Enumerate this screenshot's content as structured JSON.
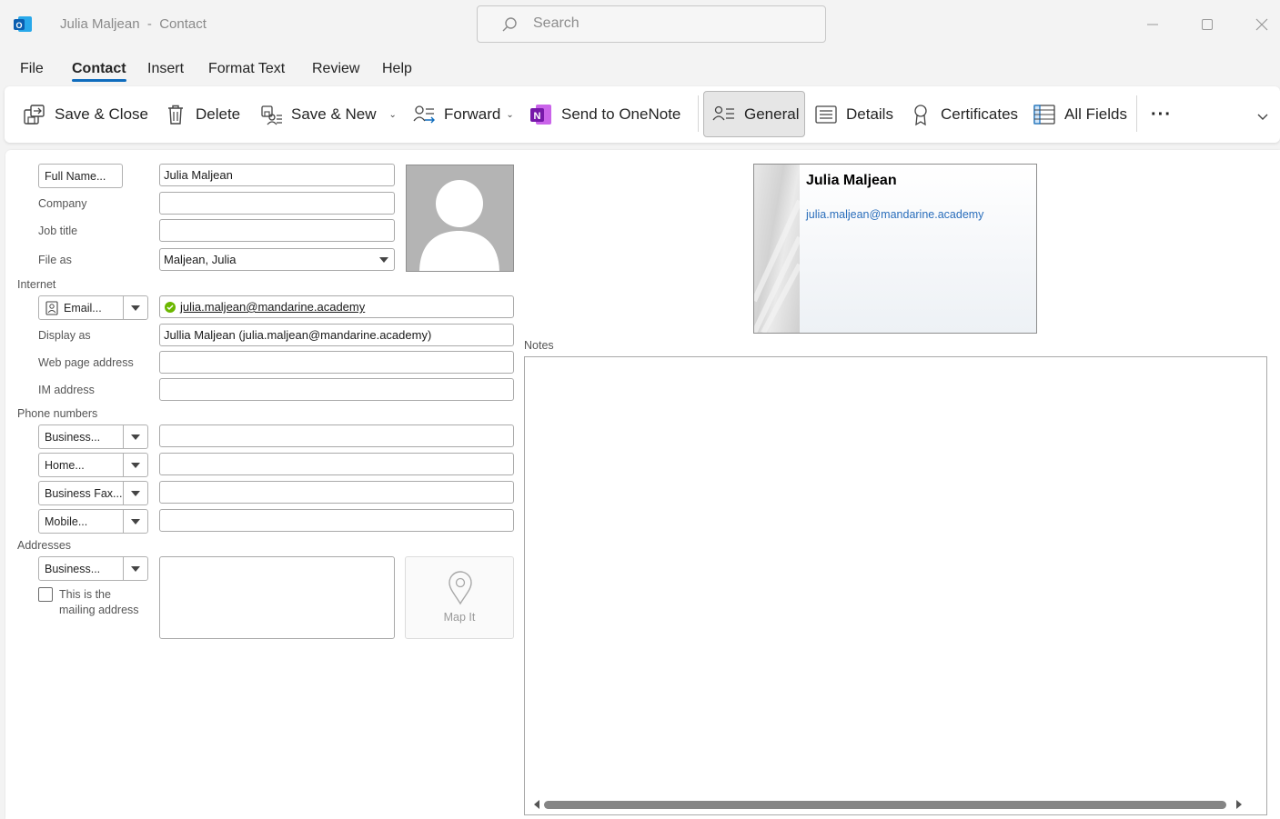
{
  "window": {
    "title": "Julia Maljean  -  Contact",
    "search_placeholder": "Search"
  },
  "menu": {
    "items": [
      "File",
      "Contact",
      "Insert",
      "Format Text",
      "Review",
      "Help"
    ],
    "active": "Contact"
  },
  "ribbon": {
    "save_close": "Save & Close",
    "delete": "Delete",
    "save_new": "Save & New",
    "forward": "Forward",
    "send_onenote": "Send to OneNote",
    "general": "General",
    "details": "Details",
    "certificates": "Certificates",
    "all_fields": "All Fields",
    "more": "···"
  },
  "form": {
    "full_name_button": "Full Name...",
    "full_name_value": "Julia Maljean",
    "company_label": "Company",
    "company_value": "",
    "job_title_label": "Job title",
    "job_title_value": "",
    "file_as_label": "File as",
    "file_as_value": "Maljean, Julia",
    "internet_section": "Internet",
    "email_button": "Email...",
    "email_value": "julia.maljean@mandarine.academy",
    "display_as_label": "Display as",
    "display_as_value": "Jullia Maljean (julia.maljean@mandarine.academy)",
    "web_page_label": "Web page address",
    "web_page_value": "",
    "im_label": "IM address",
    "im_value": "",
    "phone_section": "Phone numbers",
    "phones": [
      {
        "type": "Business...",
        "value": ""
      },
      {
        "type": "Home...",
        "value": ""
      },
      {
        "type": "Business Fax...",
        "value": ""
      },
      {
        "type": "Mobile...",
        "value": ""
      }
    ],
    "addresses_section": "Addresses",
    "address_type": "Business...",
    "address_value": "",
    "mailing_checkbox_line1": "This is the",
    "mailing_checkbox_line2": "mailing address",
    "mailing_checked": false,
    "map_it": "Map It"
  },
  "card": {
    "name": "Julia Maljean",
    "email": "julia.maljean@mandarine.academy"
  },
  "notes": {
    "label": "Notes",
    "value": ""
  },
  "colors": {
    "accent": "#0f6cbd",
    "email_link": "#2a6ebb",
    "resolved_green": "#6bb700",
    "onenote_purple": "#7719aa"
  }
}
